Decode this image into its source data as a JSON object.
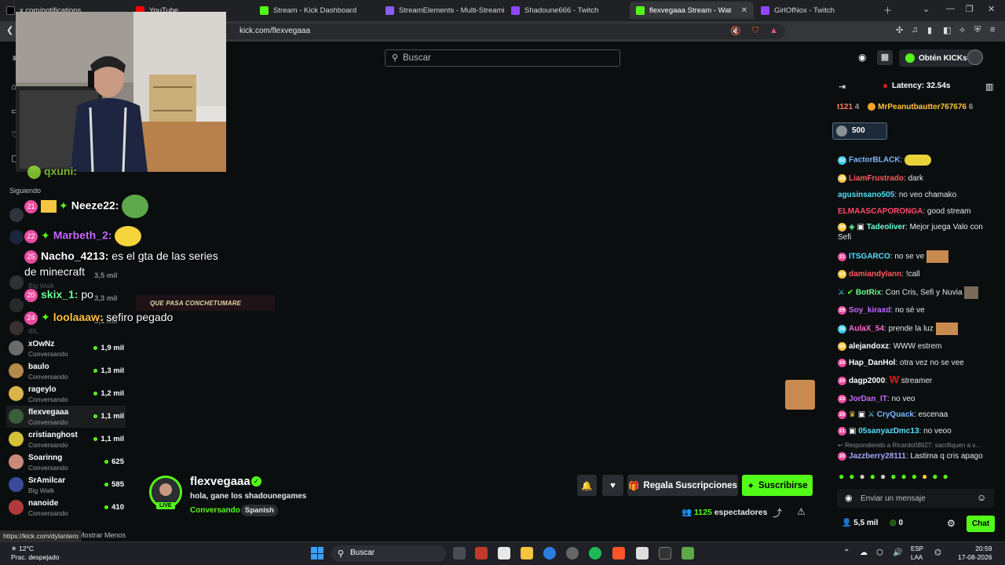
{
  "browser": {
    "tabs": [
      {
        "title": "x.com/notifications",
        "color": "#000000"
      },
      {
        "title": "YouTube",
        "color": "#ff0000"
      },
      {
        "title": "Stream - Kick Dashboard",
        "color": "#53fc18"
      },
      {
        "title": "StreamElements - Multi-Streaming",
        "color": "#8a5cf6"
      },
      {
        "title": "Shadoune666 - Twitch",
        "color": "#9146ff"
      },
      {
        "title": "flexvegaaa Stream - Watch Live",
        "color": "#53fc18"
      },
      {
        "title": "GirlOfNox - Twitch",
        "color": "#9146ff"
      }
    ],
    "url": "kick.com/flexvegaaa"
  },
  "header": {
    "search_placeholder": "Buscar",
    "get_kicks_label": "Obtén KICKs"
  },
  "sidebar": {
    "following_label": "Siguiendo",
    "channels": [
      {
        "name": "xOwNz",
        "status": "Conversando",
        "viewers": "1,9 mil",
        "color": "#6b6b6b"
      },
      {
        "name": "baulo",
        "status": "Conversando",
        "viewers": "1,3 mil",
        "color": "#b48a4a"
      },
      {
        "name": "rageylo",
        "status": "Conversando",
        "viewers": "1,2 mil",
        "color": "#d9b44a"
      },
      {
        "name": "flexvegaaa",
        "status": "Conversando",
        "viewers": "1,1 mil",
        "color": "#3a5d3a"
      },
      {
        "name": "cristianghost",
        "status": "Conversando",
        "viewers": "1,1 mil",
        "color": "#d4c13a"
      },
      {
        "name": "Soarinng",
        "status": "Conversando",
        "viewers": "625",
        "color": "#c98a7a"
      },
      {
        "name": "SrAmilcar",
        "status": "Big Walk",
        "viewers": "585",
        "color": "#3a4a9a"
      },
      {
        "name": "nanoide",
        "status": "Conversando",
        "viewers": "410",
        "color": "#b03a3a"
      }
    ],
    "faded_viewers": [
      "3,5 mil",
      "3,3 mil",
      "3,1 mil"
    ],
    "faded_labels": [
      "Big Walk",
      "IRL"
    ],
    "show_less_label": "Mostrar Menos"
  },
  "overlay_chat": [
    {
      "level": "",
      "user": "qxuni:",
      "text": "",
      "color": "#a6ff3c"
    },
    {
      "level": "21",
      "user": "Neeze22:",
      "text": "",
      "color": "#ffffff"
    },
    {
      "level": "22",
      "user": "Marbeth_2:",
      "text": "",
      "color": "#c968ff"
    },
    {
      "level": "25",
      "user": "Nacho_4213:",
      "text": "es el gta de las series",
      "color": "#ffffff"
    },
    {
      "level": "",
      "user": "",
      "text": "de minecraft",
      "color": "#ffffff"
    },
    {
      "level": "20",
      "user": "skix_1:",
      "text": "po",
      "color": "#6cff9a"
    },
    {
      "level": "24",
      "user": "loolaaaw:",
      "text": "sefiro pegado",
      "color": "#ffc341"
    }
  ],
  "alert_text": "QUE PASA CONCHETUMARE",
  "stream": {
    "name": "flexvegaaa",
    "title": "hola, gane los shadounegames",
    "category": "Conversando",
    "language": "Spanish",
    "live_badge": "LIVE",
    "gift_subs_label": "Regala Suscripciones",
    "subscribe_label": "Suscribirse",
    "viewers": "1125",
    "viewers_label": "espectadores"
  },
  "chat": {
    "latency": "Latency: 32.54s",
    "pinned": [
      {
        "user": "t121",
        "count": "4",
        "color": "#ff7a59"
      },
      {
        "user": "MrPeanutbautter767676",
        "count": "6",
        "color": "#ffc341"
      }
    ],
    "gift_amount": "500",
    "messages": [
      {
        "level": "32",
        "lvcolor": "#3cc8e6",
        "user": "FactorBLACK",
        "color": "#7ab8ff",
        "text": ""
      },
      {
        "level": "18",
        "lvcolor": "#f5c542",
        "user": "LiamFrustrado",
        "color": "#ff5a5a",
        "text": "dark"
      },
      {
        "level": "",
        "lvcolor": "",
        "user": "agusinsano505",
        "color": "#53e0ff",
        "text": "no veo chamako"
      },
      {
        "level": "",
        "lvcolor": "",
        "user": "ELMAASCAPORONGA",
        "color": "#ff4a6a",
        "text": "good stream"
      },
      {
        "level": "19",
        "lvcolor": "#f5c542",
        "user": "Tadeoliver",
        "color": "#6cffd8",
        "text": "Mejor juega Valo con Sefi"
      },
      {
        "level": "21",
        "lvcolor": "#e94aa0",
        "user": "ITSGARCO",
        "color": "#53e0ff",
        "text": "no se ve"
      },
      {
        "level": "14",
        "lvcolor": "#f5c542",
        "user": "damiandylann",
        "color": "#ff5a5a",
        "text": "!call"
      },
      {
        "level": "",
        "lvcolor": "",
        "user": "BotRix",
        "color": "#6cff9a",
        "text": "Con Cris, Sefi y Nuvia"
      },
      {
        "level": "29",
        "lvcolor": "#e94aa0",
        "user": "Soy_kiraxd",
        "color": "#c968ff",
        "text": "no sé ve"
      },
      {
        "level": "35",
        "lvcolor": "#3cc8e6",
        "user": "AulaX_54",
        "color": "#ff6ad5",
        "text": "prende la luz"
      },
      {
        "level": "16",
        "lvcolor": "#f5c542",
        "user": "alejandoxz",
        "color": "#ffffff",
        "text": "WWW estrem"
      },
      {
        "level": "20",
        "lvcolor": "#e94aa0",
        "user": "Hap_DanHol",
        "color": "#ffffff",
        "text": "otra vez no se vee"
      },
      {
        "level": "20",
        "lvcolor": "#e94aa0",
        "user": "dagp2000",
        "color": "#ffffff",
        "text": "streamer"
      },
      {
        "level": "23",
        "lvcolor": "#e94aa0",
        "user": "JorDan_IT",
        "color": "#c968ff",
        "text": "no veo"
      },
      {
        "level": "29",
        "lvcolor": "#e94aa0",
        "user": "CryQuack",
        "color": "#7ab8ff",
        "text": "escenaa"
      },
      {
        "level": "21",
        "lvcolor": "#e94aa0",
        "user": "05sanyazDmc13",
        "color": "#53e0ff",
        "text": "no veoo"
      },
      {
        "level": "20",
        "lvcolor": "#e94aa0",
        "user": "Jazzberry28111",
        "color": "#a6a6ff",
        "text": "Lastima q cris apago"
      }
    ],
    "reply_hint": "Respondiendo a Ricardo08927: sacrifiquen a v...",
    "input_placeholder": "Enviar un mensaje",
    "followers": "5,5 mil",
    "kicks": "0",
    "send_label": "Chat"
  },
  "status_link": "https://kick.com/dylantero",
  "taskbar": {
    "temperature": "12°C",
    "weather": "Prac. despejado",
    "search_label": "Buscar",
    "lang_top": "ESP",
    "lang_bottom": "LAA",
    "time": "20:59",
    "date": "17-08-2026"
  }
}
